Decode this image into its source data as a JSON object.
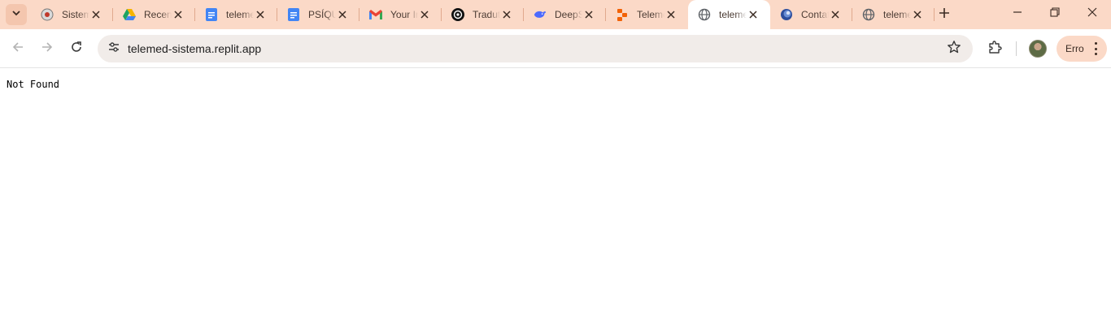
{
  "tabs": [
    {
      "title": "Sistema",
      "icon": "chrome-globe-icon"
    },
    {
      "title": "Recentes",
      "icon": "google-drive-icon"
    },
    {
      "title": "telemed",
      "icon": "google-docs-icon"
    },
    {
      "title": "PSÍQUICO",
      "icon": "google-docs-icon"
    },
    {
      "title": "Your Inbox",
      "icon": "gmail-icon"
    },
    {
      "title": "Tradutor",
      "icon": "openai-icon"
    },
    {
      "title": "DeepSeek",
      "icon": "deepseek-icon"
    },
    {
      "title": "Telemed",
      "icon": "replit-icon"
    },
    {
      "title": "telemed",
      "icon": "globe-icon",
      "active": true
    },
    {
      "title": "Contatos",
      "icon": "globe-blue-icon"
    },
    {
      "title": "telemed",
      "icon": "globe-icon"
    }
  ],
  "toolbar": {
    "url": "telemed-sistema.replit.app",
    "profile_button_label": "Erro"
  },
  "page": {
    "text": "Not Found"
  },
  "colors": {
    "frame": "#fbd9c7",
    "omnibox": "#f1ece9"
  }
}
